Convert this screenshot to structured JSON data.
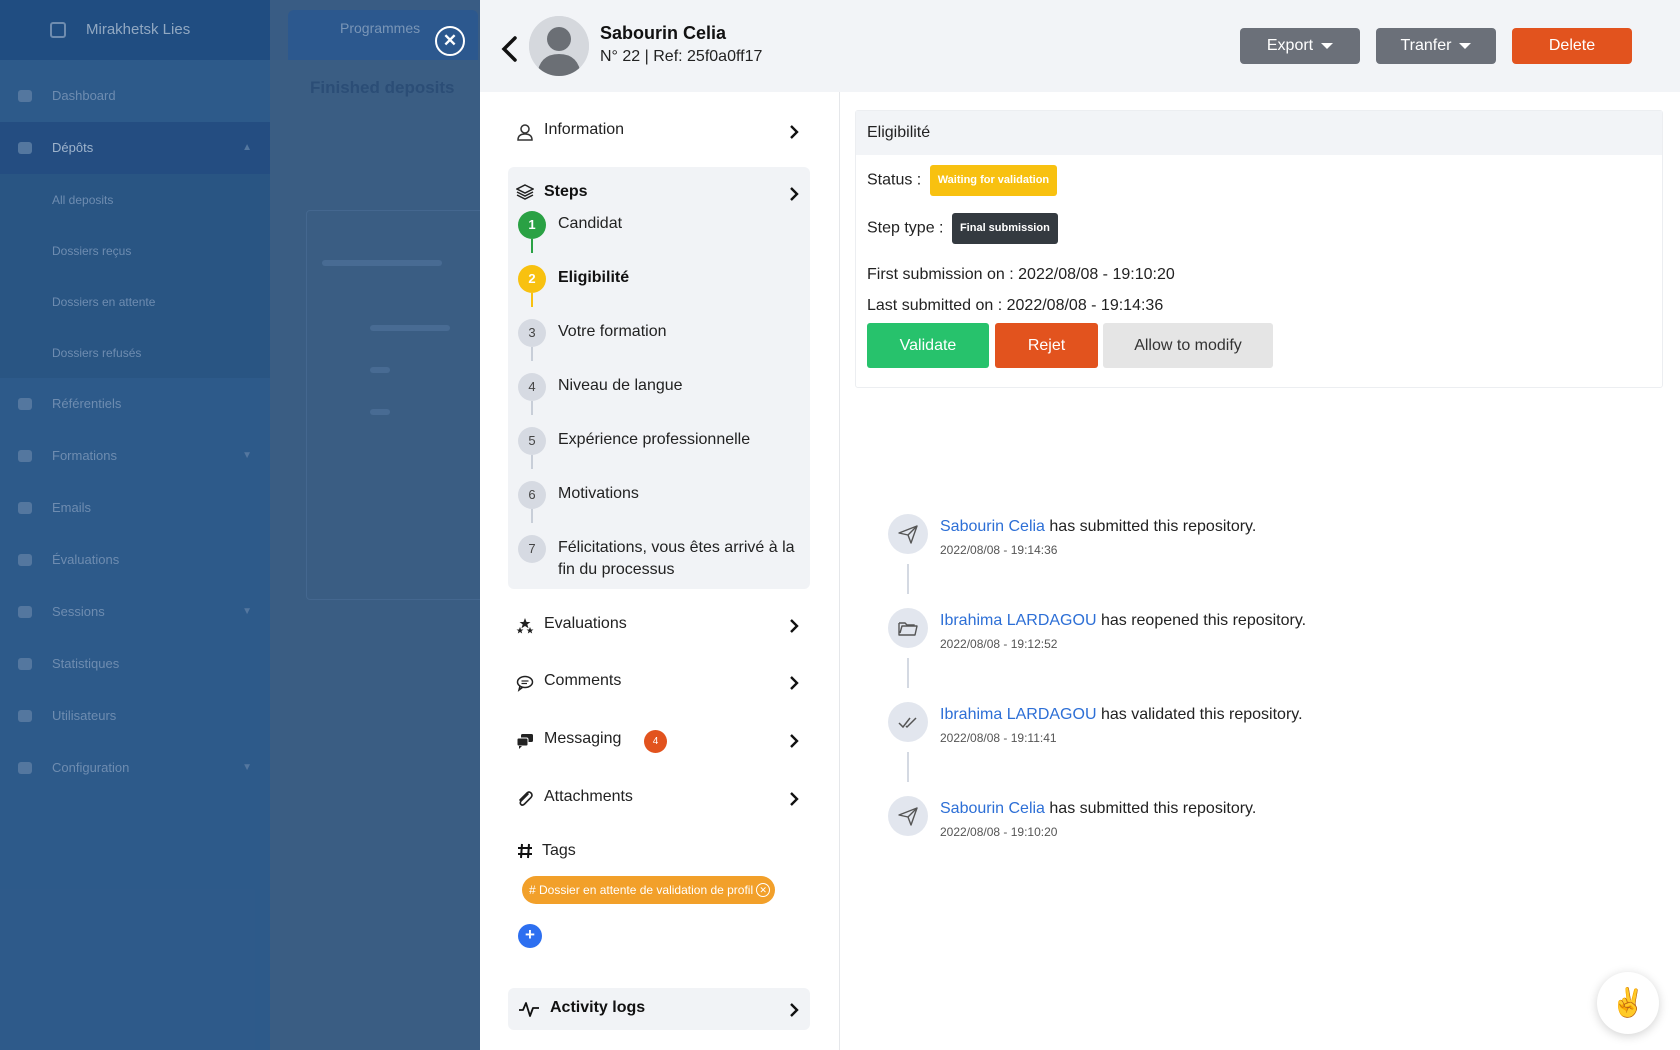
{
  "background": {
    "brand": "Mirakhetsk Lies",
    "nav_items": [
      "Dashboard",
      "Dépôts",
      "All deposits",
      "Dossiers reçus",
      "Dossiers en attente",
      "Dossiers refusés",
      "Référentiels",
      "Formations",
      "Emails",
      "Évaluations",
      "Sessions",
      "Statistiques",
      "Utilisateurs",
      "Configuration"
    ],
    "tab_title": "Programmes",
    "page_title": "Finished deposits"
  },
  "candidate": {
    "name": "Sabourin Celia",
    "ref_line": "N° 22 | Ref: 25f0a0ff17"
  },
  "header_actions": {
    "export": "Export",
    "transfer": "Tranfer",
    "delete": "Delete"
  },
  "menu": {
    "information": "Information",
    "steps": "Steps",
    "evaluations": "Evaluations",
    "comments": "Comments",
    "messaging": "Messaging",
    "messaging_count": "4",
    "attachments": "Attachments",
    "tags": "Tags",
    "activity_logs": "Activity logs"
  },
  "steps": [
    {
      "num": "1",
      "label": "Candidat",
      "state": "done"
    },
    {
      "num": "2",
      "label": "Eligibilité",
      "state": "current"
    },
    {
      "num": "3",
      "label": "Votre formation",
      "state": "todo"
    },
    {
      "num": "4",
      "label": "Niveau de langue",
      "state": "todo"
    },
    {
      "num": "5",
      "label": "Expérience professionnelle",
      "state": "todo"
    },
    {
      "num": "6",
      "label": "Motivations",
      "state": "todo"
    },
    {
      "num": "7",
      "label": "Félicitations, vous êtes arrivé à la fin du processus",
      "state": "todo"
    }
  ],
  "tags": {
    "chips": [
      "# Dossier en attente de validation de profil"
    ],
    "add": "+"
  },
  "eligibility": {
    "title": "Eligibilité",
    "status_label": "Status :",
    "status_value": "Waiting for validation",
    "step_type_label": "Step type :",
    "step_type_value": "Final submission",
    "first_submission": "First submission on : 2022/08/08 - 19:10:20",
    "last_submitted": "Last submitted on : 2022/08/08 - 19:14:36",
    "validate": "Validate",
    "reject": "Rejet",
    "allow": "Allow to modify"
  },
  "timeline": [
    {
      "icon": "paper-plane-icon",
      "who": "Sabourin Celia",
      "action": " has submitted this repository.",
      "date": "2022/08/08 - 19:14:36"
    },
    {
      "icon": "folder-open-icon",
      "who": "Ibrahima LARDAGOU",
      "action": " has reopened this repository.",
      "date": "2022/08/08 - 19:12:52"
    },
    {
      "icon": "double-check-icon",
      "who": "Ibrahima LARDAGOU",
      "action": " has validated this repository.",
      "date": "2022/08/08 - 19:11:41"
    },
    {
      "icon": "paper-plane-icon",
      "who": "Sabourin Celia",
      "action": " has submitted this repository.",
      "date": "2022/08/08 - 19:10:20"
    }
  ],
  "colors": {
    "accent_blue": "#2d6fd6",
    "success": "#27c26c",
    "danger": "#e2531e",
    "warning": "#f8c110",
    "tag": "#f2a02a"
  },
  "fab_icon": "✌"
}
